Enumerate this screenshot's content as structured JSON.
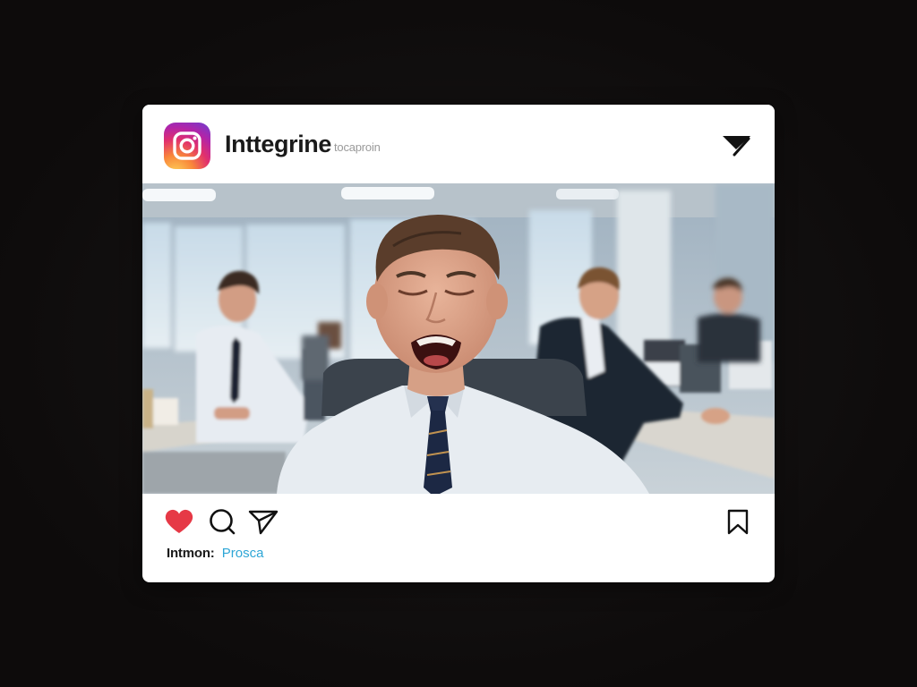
{
  "post": {
    "app_name": "Inttegrine",
    "app_handle": "tocaproin",
    "caption_user": "Intmon:",
    "caption_tag": "Prosca"
  },
  "icons": {
    "logo": "instagram-logo-icon",
    "menu": "filter-triangle-icon",
    "like": "heart-icon",
    "comment": "comment-bubble-icon",
    "share": "paper-plane-icon",
    "save": "bookmark-icon"
  },
  "colors": {
    "like_active": "#e63946",
    "tag": "#2ea6d6",
    "text": "#1a1a1a",
    "background": "#0f0d0d"
  },
  "state": {
    "liked": true
  }
}
